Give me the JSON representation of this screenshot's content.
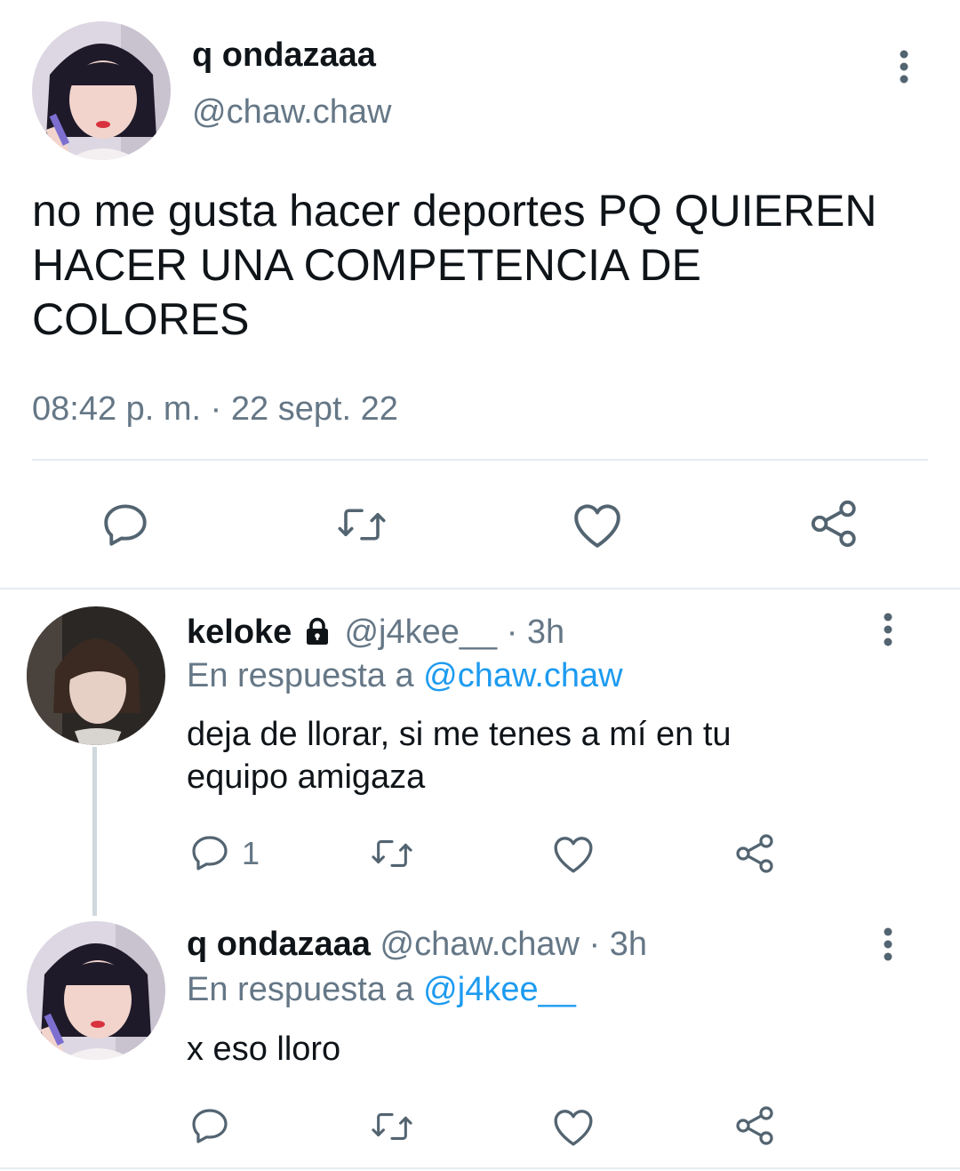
{
  "main_tweet": {
    "display_name": "q ondazaaa",
    "handle": "@chaw.chaw",
    "text": "no me gusta hacer deportes PQ QUIEREN HACER UNA COMPETENCIA DE COLORES",
    "timestamp": "08:42 p. m. · 22 sept. 22",
    "actions": [
      "reply-icon",
      "retweet-icon",
      "like-icon",
      "share-icon"
    ]
  },
  "replies": [
    {
      "display_name": "keloke",
      "locked": true,
      "handle": "@j4kee__",
      "time": "· 3h",
      "reply_prefix": "En respuesta a",
      "reply_to": "@chaw.chaw",
      "text": "deja de llorar, si me tenes a mí en tu equipo amigaza",
      "reply_count": "1"
    },
    {
      "display_name": "q ondazaaa",
      "handle": "@chaw.chaw",
      "time": "· 3h",
      "reply_prefix": "En respuesta a",
      "reply_to": "@j4kee__",
      "text": "x eso lloro",
      "reply_count": ""
    }
  ],
  "colors": {
    "text": "#0f1419",
    "secondary": "#657786",
    "link": "#1d9bf0",
    "divider": "#e6ecf0"
  }
}
